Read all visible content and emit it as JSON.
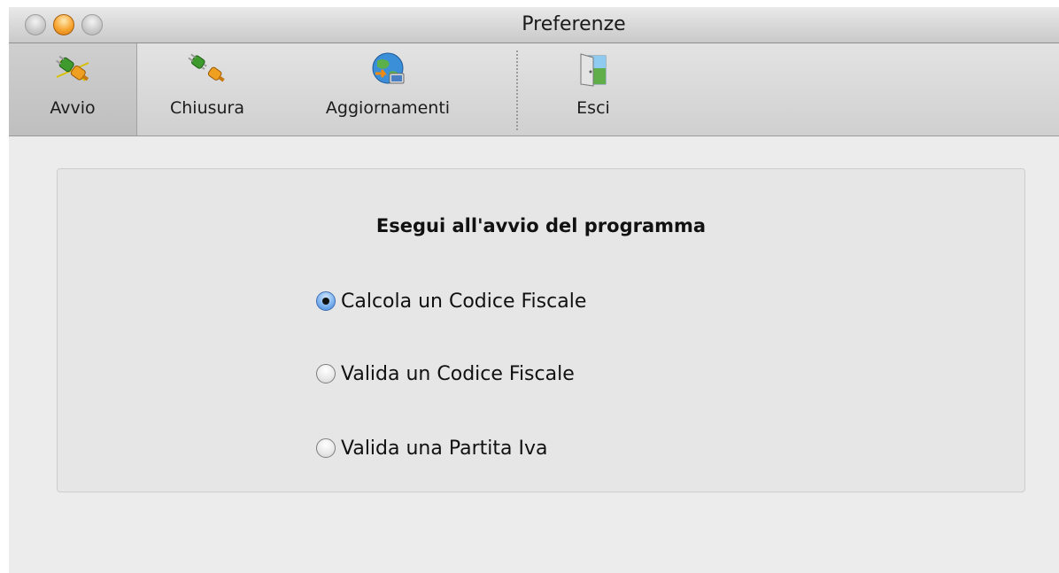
{
  "window": {
    "title": "Preferenze"
  },
  "toolbar": {
    "items": [
      {
        "label": "Avvio",
        "icon": "plug-connect-icon",
        "selected": true
      },
      {
        "label": "Chiusura",
        "icon": "plug-disconnect-icon",
        "selected": false
      },
      {
        "label": "Aggiornamenti",
        "icon": "globe-update-icon",
        "selected": false
      },
      {
        "label": "Esci",
        "icon": "exit-door-icon",
        "selected": false
      }
    ]
  },
  "startup": {
    "heading": "Esegui all'avvio del programma",
    "options": [
      {
        "label": "Calcola un Codice Fiscale",
        "checked": true
      },
      {
        "label": "Valida un Codice Fiscale",
        "checked": false
      },
      {
        "label": "Valida una Partita Iva",
        "checked": false
      }
    ]
  },
  "colors": {
    "window_bg": "#ececec",
    "radio_selected": "#3d7fd3",
    "close_button": "#f7a531"
  }
}
